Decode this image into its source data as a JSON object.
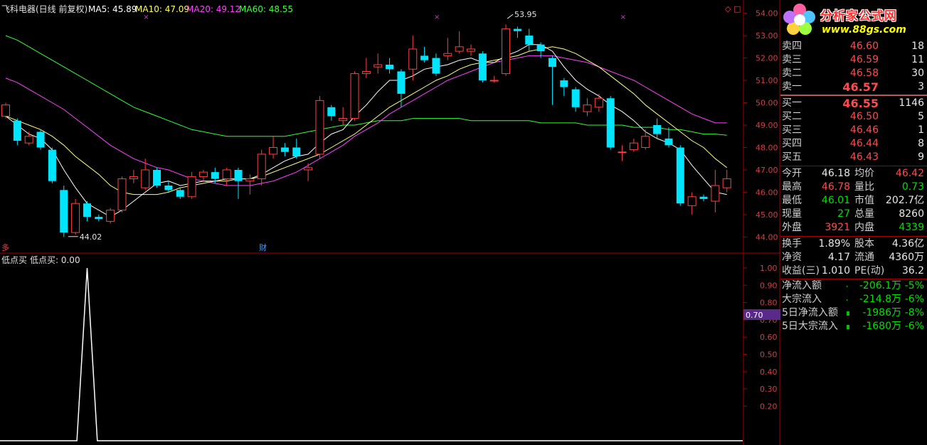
{
  "title_bar": {
    "stock_title": "飞科电器(日线 前复权)",
    "indicators": [
      {
        "label": "MA5: 45.89",
        "color": "#ffffff"
      },
      {
        "label": "MA10: 47.09",
        "color": "#ffff66"
      },
      {
        "label": "MA20: 49.12",
        "color": "#ff40ff"
      },
      {
        "label": "MA60: 48.55",
        "color": "#40ff40"
      }
    ]
  },
  "main_chart": {
    "price_ticks": [
      "54.00",
      "53.00",
      "52.00",
      "51.00",
      "50.00",
      "49.00",
      "48.00",
      "47.00",
      "46.00",
      "45.00",
      "44.00"
    ],
    "price_range": [
      43.6,
      54.4
    ],
    "high_marker": "53.95",
    "low_marker": "44.02",
    "event_marker_left": "多",
    "event_marker_fin": "财",
    "candles": [
      {
        "o": 49.4,
        "c": 49.9,
        "h": 50.0,
        "l": 49.3
      },
      {
        "o": 49.2,
        "c": 48.3,
        "h": 49.3,
        "l": 48.1
      },
      {
        "o": 48.2,
        "c": 48.5,
        "h": 48.7,
        "l": 48.1
      },
      {
        "o": 48.7,
        "c": 48.0,
        "h": 48.8,
        "l": 47.9
      },
      {
        "o": 47.9,
        "c": 46.5,
        "h": 48.0,
        "l": 46.4
      },
      {
        "o": 46.1,
        "c": 44.2,
        "h": 46.3,
        "l": 44.0
      },
      {
        "o": 44.2,
        "c": 45.5,
        "h": 45.7,
        "l": 44.1
      },
      {
        "o": 45.5,
        "c": 44.9,
        "h": 45.6,
        "l": 44.7
      },
      {
        "o": 44.9,
        "c": 44.8,
        "h": 45.0,
        "l": 44.7
      },
      {
        "o": 44.7,
        "c": 45.2,
        "h": 45.3,
        "l": 44.6
      },
      {
        "o": 45.2,
        "c": 46.6,
        "h": 46.7,
        "l": 45.1
      },
      {
        "o": 46.6,
        "c": 46.7,
        "h": 47.0,
        "l": 46.4
      },
      {
        "o": 46.2,
        "c": 47.0,
        "h": 47.5,
        "l": 46.1
      },
      {
        "o": 47.0,
        "c": 46.3,
        "h": 47.1,
        "l": 46.2
      },
      {
        "o": 46.3,
        "c": 46.1,
        "h": 46.5,
        "l": 46.0
      },
      {
        "o": 46.1,
        "c": 45.8,
        "h": 46.2,
        "l": 45.7
      },
      {
        "o": 45.8,
        "c": 46.7,
        "h": 46.9,
        "l": 45.7
      },
      {
        "o": 46.7,
        "c": 46.9,
        "h": 47.0,
        "l": 46.5
      },
      {
        "o": 46.9,
        "c": 46.6,
        "h": 47.1,
        "l": 46.4
      },
      {
        "o": 46.6,
        "c": 47.0,
        "h": 47.1,
        "l": 46.3
      },
      {
        "o": 47.0,
        "c": 46.5,
        "h": 47.1,
        "l": 45.7
      },
      {
        "o": 46.5,
        "c": 46.6,
        "h": 46.8,
        "l": 45.9
      },
      {
        "o": 46.6,
        "c": 47.7,
        "h": 47.9,
        "l": 46.3
      },
      {
        "o": 47.7,
        "c": 48.0,
        "h": 48.5,
        "l": 47.5
      },
      {
        "o": 48.0,
        "c": 47.8,
        "h": 48.2,
        "l": 47.6
      },
      {
        "o": 48.0,
        "c": 47.6,
        "h": 48.4,
        "l": 47.5
      },
      {
        "o": 47.0,
        "c": 47.1,
        "h": 47.3,
        "l": 46.5
      },
      {
        "o": 47.7,
        "c": 50.1,
        "h": 50.3,
        "l": 47.5
      },
      {
        "o": 49.8,
        "c": 49.4,
        "h": 49.9,
        "l": 49.2
      },
      {
        "o": 49.2,
        "c": 49.3,
        "h": 49.8,
        "l": 49.0
      },
      {
        "o": 49.3,
        "c": 51.3,
        "h": 51.4,
        "l": 49.2
      },
      {
        "o": 51.3,
        "c": 51.4,
        "h": 52.0,
        "l": 51.1
      },
      {
        "o": 51.6,
        "c": 51.7,
        "h": 52.2,
        "l": 51.3
      },
      {
        "o": 51.7,
        "c": 51.5,
        "h": 52.0,
        "l": 51.3
      },
      {
        "o": 51.4,
        "c": 50.4,
        "h": 51.5,
        "l": 49.8
      },
      {
        "o": 51.5,
        "c": 52.4,
        "h": 53.0,
        "l": 51.0
      },
      {
        "o": 52.1,
        "c": 51.9,
        "h": 52.5,
        "l": 51.8
      },
      {
        "o": 52.0,
        "c": 51.3,
        "h": 52.2,
        "l": 51.2
      },
      {
        "o": 52.1,
        "c": 52.2,
        "h": 52.9,
        "l": 51.9
      },
      {
        "o": 52.3,
        "c": 52.5,
        "h": 53.2,
        "l": 52.2
      },
      {
        "o": 52.3,
        "c": 52.4,
        "h": 52.6,
        "l": 52.1
      },
      {
        "o": 52.2,
        "c": 51.0,
        "h": 52.3,
        "l": 50.9
      },
      {
        "o": 51.0,
        "c": 51.0,
        "h": 51.2,
        "l": 50.9
      },
      {
        "o": 51.3,
        "c": 53.3,
        "h": 53.5,
        "l": 51.2
      },
      {
        "o": 53.3,
        "c": 53.2,
        "h": 53.4,
        "l": 52.9
      },
      {
        "o": 53.0,
        "c": 52.6,
        "h": 53.3,
        "l": 52.3
      },
      {
        "o": 52.6,
        "c": 52.3,
        "h": 52.7,
        "l": 52.0
      },
      {
        "o": 52.0,
        "c": 51.6,
        "h": 52.1,
        "l": 49.9
      },
      {
        "o": 51.0,
        "c": 50.7,
        "h": 51.1,
        "l": 50.3
      },
      {
        "o": 50.6,
        "c": 49.8,
        "h": 50.7,
        "l": 49.6
      },
      {
        "o": 49.6,
        "c": 49.9,
        "h": 50.2,
        "l": 49.4
      },
      {
        "o": 49.8,
        "c": 50.2,
        "h": 50.4,
        "l": 49.6
      },
      {
        "o": 50.2,
        "c": 48.0,
        "h": 50.3,
        "l": 47.9
      },
      {
        "o": 47.8,
        "c": 47.8,
        "h": 48.1,
        "l": 47.4
      },
      {
        "o": 47.9,
        "c": 48.2,
        "h": 48.4,
        "l": 47.8
      },
      {
        "o": 48.0,
        "c": 48.5,
        "h": 48.8,
        "l": 47.9
      },
      {
        "o": 49.0,
        "c": 48.6,
        "h": 49.3,
        "l": 48.4
      },
      {
        "o": 48.4,
        "c": 48.1,
        "h": 48.9,
        "l": 48.0
      },
      {
        "o": 48.0,
        "c": 45.5,
        "h": 48.1,
        "l": 45.4
      },
      {
        "o": 45.4,
        "c": 45.8,
        "h": 46.0,
        "l": 45.0
      },
      {
        "o": 45.8,
        "c": 45.7,
        "h": 45.9,
        "l": 45.6
      },
      {
        "o": 45.6,
        "c": 46.3,
        "h": 47.0,
        "l": 45.1
      },
      {
        "o": 46.2,
        "c": 46.6,
        "h": 47.0,
        "l": 46.0
      }
    ],
    "ma5": [
      49.4,
      49.0,
      48.6,
      48.4,
      47.9,
      47.0,
      46.2,
      45.5,
      45.2,
      44.9,
      45.2,
      45.6,
      46.0,
      46.4,
      46.5,
      46.3,
      46.4,
      46.5,
      46.5,
      46.6,
      46.6,
      46.6,
      46.8,
      47.1,
      47.4,
      47.6,
      47.7,
      48.2,
      48.6,
      48.8,
      49.4,
      49.9,
      50.5,
      51.0,
      51.0,
      51.2,
      51.5,
      51.6,
      51.7,
      51.9,
      52.0,
      51.8,
      51.8,
      52.1,
      52.3,
      52.6,
      52.6,
      52.3,
      51.6,
      51.0,
      50.6,
      50.3,
      49.9,
      49.6,
      49.2,
      48.7,
      48.4,
      48.2,
      47.9,
      47.2,
      46.6,
      46.0,
      45.9
    ],
    "ma10": [
      49.4,
      49.2,
      49.0,
      48.8,
      48.5,
      48.1,
      47.6,
      47.2,
      46.8,
      46.3,
      46.0,
      45.9,
      45.9,
      45.9,
      46.0,
      46.2,
      46.3,
      46.4,
      46.5,
      46.5,
      46.6,
      46.6,
      46.7,
      46.9,
      47.1,
      47.3,
      47.5,
      47.7,
      48.0,
      48.3,
      48.6,
      49.0,
      49.4,
      49.8,
      50.1,
      50.4,
      50.7,
      51.0,
      51.2,
      51.5,
      51.7,
      51.8,
      51.9,
      52.0,
      52.1,
      52.3,
      52.4,
      52.5,
      52.4,
      52.2,
      51.9,
      51.6,
      51.2,
      50.8,
      50.4,
      49.9,
      49.5,
      49.1,
      48.7,
      48.3,
      48.0,
      47.5,
      47.1
    ],
    "ma20": [
      51.1,
      50.9,
      50.6,
      50.3,
      50.0,
      49.7,
      49.3,
      48.9,
      48.5,
      48.1,
      47.8,
      47.5,
      47.3,
      47.1,
      47.0,
      46.8,
      46.6,
      46.5,
      46.4,
      46.3,
      46.3,
      46.3,
      46.4,
      46.5,
      46.7,
      46.9,
      47.2,
      47.5,
      47.8,
      48.1,
      48.5,
      48.8,
      49.1,
      49.5,
      49.8,
      50.1,
      50.4,
      50.7,
      51.0,
      51.2,
      51.4,
      51.6,
      51.8,
      51.9,
      52.0,
      52.1,
      52.1,
      52.1,
      52.0,
      51.9,
      51.8,
      51.6,
      51.4,
      51.2,
      51.0,
      50.7,
      50.4,
      50.1,
      49.8,
      49.5,
      49.3,
      49.1,
      49.1
    ],
    "ma60": [
      53.0,
      52.8,
      52.5,
      52.2,
      51.9,
      51.6,
      51.3,
      51.0,
      50.7,
      50.4,
      50.1,
      49.8,
      49.6,
      49.4,
      49.2,
      49.0,
      48.8,
      48.7,
      48.6,
      48.5,
      48.5,
      48.5,
      48.5,
      48.5,
      48.5,
      48.6,
      48.7,
      48.8,
      48.9,
      49.0,
      49.0,
      49.1,
      49.2,
      49.2,
      49.2,
      49.3,
      49.3,
      49.3,
      49.3,
      49.3,
      49.2,
      49.2,
      49.2,
      49.2,
      49.2,
      49.2,
      49.1,
      49.1,
      49.1,
      49.1,
      49.0,
      49.0,
      49.0,
      49.0,
      48.9,
      48.9,
      48.9,
      48.8,
      48.8,
      48.7,
      48.6,
      48.6,
      48.55
    ]
  },
  "sub_chart": {
    "title": "低点买",
    "value_label": "低点买: 0.00",
    "ticks": [
      "1.00",
      "0.90",
      "0.80",
      "0.70",
      "0.60",
      "0.50",
      "0.40",
      "0.30",
      "0.20"
    ],
    "current_badge": "0.70",
    "spike_index": 7
  },
  "panel": {
    "logo_text": "分析家公式网",
    "logo_url": "www.88gs.com",
    "sell": [
      {
        "label": "卖四",
        "price": "46.60",
        "vol": "18"
      },
      {
        "label": "卖三",
        "price": "46.59",
        "vol": "11"
      },
      {
        "label": "卖二",
        "price": "46.58",
        "vol": "30"
      },
      {
        "label": "卖一",
        "price": "46.57",
        "vol": "3"
      }
    ],
    "buy": [
      {
        "label": "买一",
        "price": "46.55",
        "vol": "1146"
      },
      {
        "label": "买二",
        "price": "46.50",
        "vol": "5"
      },
      {
        "label": "买三",
        "price": "46.46",
        "vol": "1"
      },
      {
        "label": "买四",
        "price": "46.44",
        "vol": "8"
      },
      {
        "label": "买五",
        "price": "46.43",
        "vol": "9"
      }
    ],
    "stats": [
      {
        "l1": "今开",
        "v1": "46.18",
        "c1": "white",
        "l2": "均价",
        "v2": "46.42",
        "c2": "red"
      },
      {
        "l1": "最高",
        "v1": "46.78",
        "c1": "red",
        "l2": "量比",
        "v2": "0.73",
        "c2": "green"
      },
      {
        "l1": "最低",
        "v1": "46.01",
        "c1": "green",
        "l2": "市值",
        "v2": "202.7亿",
        "c2": "white"
      },
      {
        "l1": "现量",
        "v1": "27",
        "c1": "green",
        "l2": "总量",
        "v2": "8260",
        "c2": "white"
      },
      {
        "l1": "外盘",
        "v1": "3921",
        "c1": "red",
        "l2": "内盘",
        "v2": "4339",
        "c2": "green"
      }
    ],
    "stats2": [
      {
        "l1": "换手",
        "v1": "1.89%",
        "l2": "股本",
        "v2": "4.36亿"
      },
      {
        "l1": "净资",
        "v1": "4.17",
        "l2": "流通",
        "v2": "4360万"
      },
      {
        "l1": "收益(三)",
        "v1": "1.010",
        "l2": "PE(动)",
        "v2": "36.2"
      }
    ],
    "flows": [
      {
        "label": "净流入额",
        "value": "-206.1万",
        "pct": "-5%"
      },
      {
        "label": "大宗流入",
        "value": "-214.8万",
        "pct": "-6%"
      },
      {
        "label": "5日净流入额",
        "value": "-1986万",
        "pct": "-8%"
      },
      {
        "label": "5日大宗流入",
        "value": "-1680万",
        "pct": "-6%"
      }
    ]
  }
}
